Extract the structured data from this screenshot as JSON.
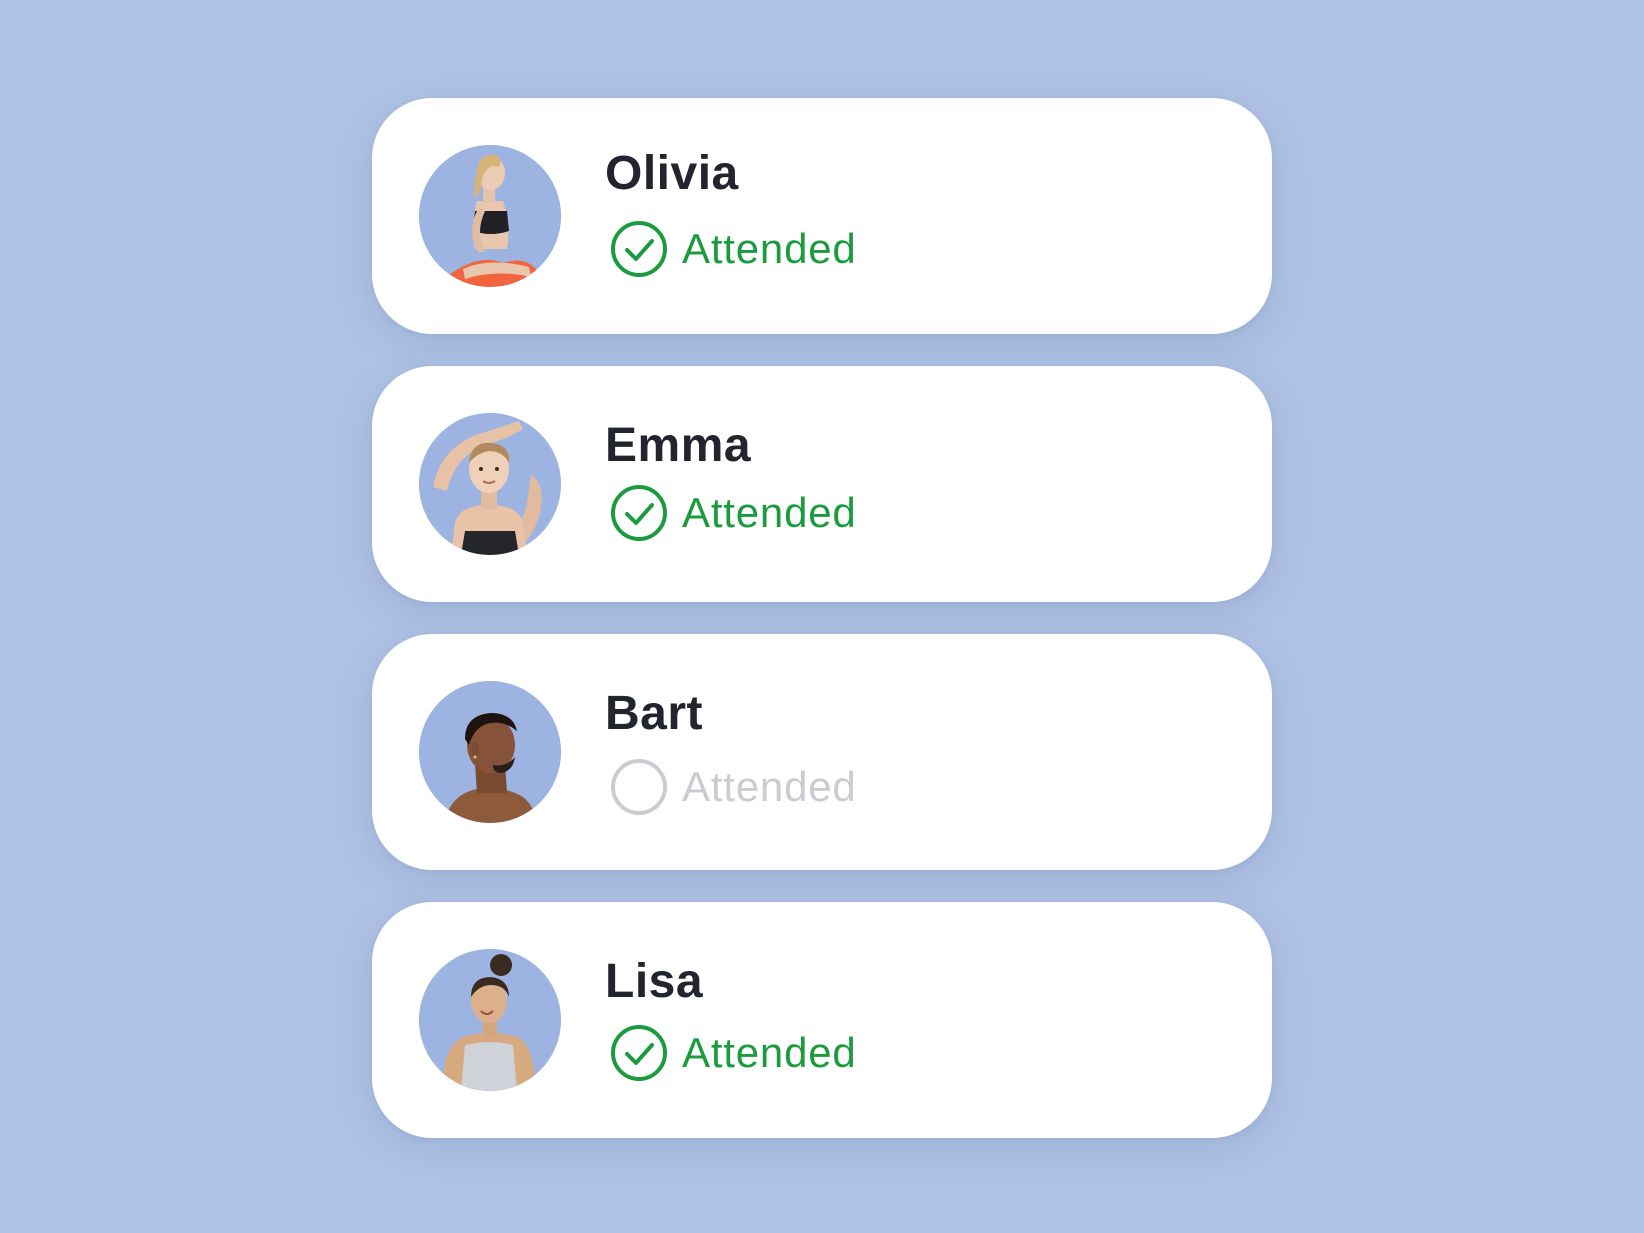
{
  "colors": {
    "background": "#afc2e4",
    "card": "#ffffff",
    "name_text": "#22252e",
    "attended": "#1c9b3e",
    "not_attended": "#c9ccd1",
    "avatar_bg": "#9db4e3"
  },
  "attendees": [
    {
      "name": "Olivia",
      "status_label": "Attended",
      "attended": true,
      "check_icon": "check-circle-icon"
    },
    {
      "name": "Emma",
      "status_label": "Attended",
      "attended": true,
      "check_icon": "check-circle-icon"
    },
    {
      "name": "Bart",
      "status_label": "Attended",
      "attended": false,
      "check_icon": "empty-circle-icon"
    },
    {
      "name": "Lisa",
      "status_label": "Attended",
      "attended": true,
      "check_icon": "check-circle-icon"
    }
  ]
}
